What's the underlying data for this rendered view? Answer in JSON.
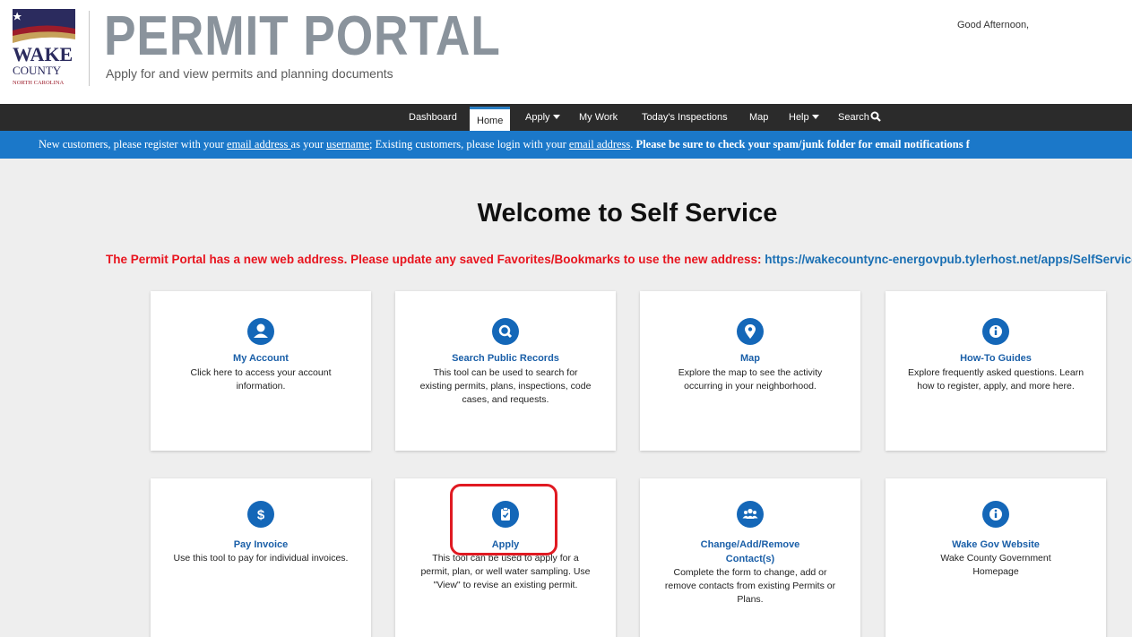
{
  "header": {
    "logo_text": [
      "WAKE",
      "COUNTY",
      "NORTH CAROLINA"
    ],
    "title": "PERMIT PORTAL",
    "subtitle": "Apply for and view permits and planning documents",
    "greeting": "Good Afternoon,"
  },
  "nav": {
    "items": [
      {
        "label": "Dashboard"
      },
      {
        "label": "Home",
        "active": true
      },
      {
        "label": "Apply"
      },
      {
        "label": "My Work"
      },
      {
        "label": "Today's Inspections"
      },
      {
        "label": "Map"
      },
      {
        "label": "Help"
      },
      {
        "label": "Search"
      }
    ]
  },
  "banner": {
    "part1": "New customers, please register with your ",
    "link1": "email address ",
    "part2": "as your ",
    "link2": "username",
    "part3": "; Existing customers, please login with your ",
    "link3": "email address",
    "part4": ".  ",
    "bold": "Please be sure to check your spam/junk folder for email notifications f"
  },
  "main": {
    "welcome": "Welcome to Self Service",
    "notice_red": "The Permit Portal has a new web address. Please update any saved Favorites/Bookmarks to use the new address: ",
    "notice_link": "https://wakecountync-energovpub.tylerhost.net/apps/SelfService#/h"
  },
  "cards": [
    {
      "title": "My Account",
      "desc": "Click here to access your account information.",
      "icon": "user-icon"
    },
    {
      "title": "Search Public Records",
      "desc": "This tool can be used to search for existing permits, plans, inspections, code cases, and requests.",
      "icon": "search-icon"
    },
    {
      "title": "Map",
      "desc": "Explore the map to see the activity occurring in your neighborhood.",
      "icon": "map-pin-icon"
    },
    {
      "title": "How-To Guides",
      "desc": "Explore frequently asked questions. Learn how to register, apply, and more here.",
      "icon": "info-icon"
    },
    {
      "title": "Pay Invoice",
      "desc": "Use this tool to pay for individual invoices.",
      "icon": "dollar-icon"
    },
    {
      "title": "Apply",
      "desc": "This tool can be used to apply for a permit, plan, or well water sampling. Use \"View\" to revise an existing permit.",
      "icon": "clipboard-check-icon"
    },
    {
      "title": "Change/Add/Remove Contact(s)",
      "desc": "Complete the form to change, add or remove contacts from existing Permits or Plans.",
      "icon": "users-icon"
    },
    {
      "title": "Wake Gov Website",
      "desc": "Wake County Government Homepage",
      "icon": "info-icon"
    }
  ],
  "colors": {
    "nav_bg": "#2b2b2b",
    "banner_bg": "#1b78c9",
    "accent_blue": "#1467b8",
    "notice_red": "#e8141e",
    "highlight_red": "#e01a22"
  }
}
